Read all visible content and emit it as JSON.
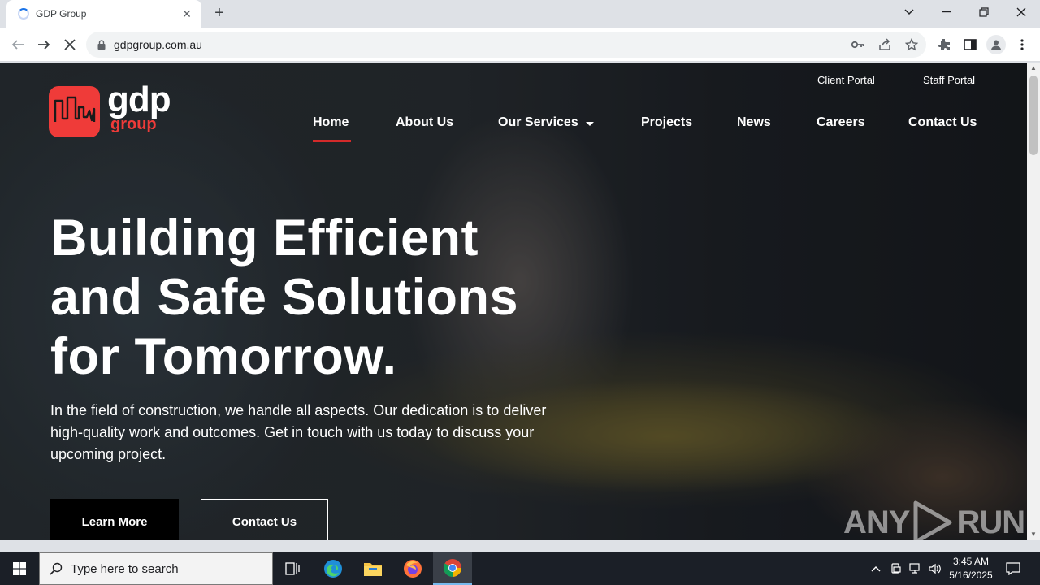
{
  "browser": {
    "tab_title": "GDP Group",
    "url": "gdpgroup.com.au"
  },
  "site": {
    "logo": {
      "word": "gdp",
      "sub": "group",
      "brand_color": "#ef3b39"
    },
    "top_links": [
      "Client Portal",
      "Staff Portal"
    ],
    "nav": [
      "Home",
      "About Us",
      "Our Services",
      "Projects",
      "News",
      "Careers",
      "Contact Us"
    ],
    "active_nav": "Home",
    "hero": {
      "title_lines": [
        "Building Efficient",
        "and Safe Solutions",
        "for Tomorrow."
      ],
      "text_lines": [
        "In the field of construction, we handle all aspects. Our dedication is to deliver",
        "high-quality work and outcomes. Get in touch with us today to discuss your",
        "upcoming project."
      ],
      "primary_button": "Learn More",
      "secondary_button": "Contact Us"
    },
    "watermark": {
      "left": "ANY",
      "right": "RUN"
    }
  },
  "taskbar": {
    "search_placeholder": "Type here to search",
    "time": "3:45 AM",
    "date": "5/16/2025"
  },
  "colors": {
    "accent_red": "#d32a2a",
    "taskbar_bg": "#1b1f27"
  }
}
